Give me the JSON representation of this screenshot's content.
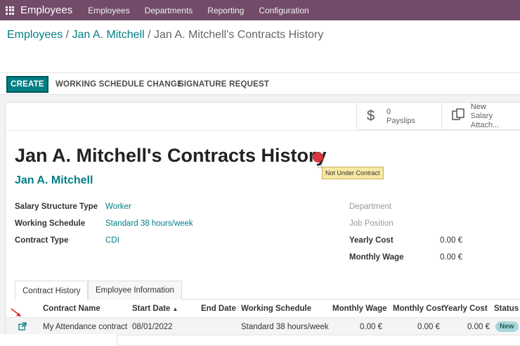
{
  "navbar": {
    "brand": "Employees",
    "items": [
      "Employees",
      "Departments",
      "Reporting",
      "Configuration"
    ]
  },
  "breadcrumb": {
    "item1": "Employees",
    "item2": "Jan A. Mitchell",
    "current": "Jan A. Mitchell's Contracts History",
    "separator": "/"
  },
  "toolbar": {
    "create": "CREATE",
    "working_schedule_change": "WORKING SCHEDULE CHANGE",
    "signature_request": "SIGNATURE REQUEST"
  },
  "smart_buttons": {
    "payslips": {
      "value": "0",
      "label": "Payslips",
      "icon": "dollar-icon"
    },
    "salary_attachments": {
      "value": "New",
      "label": "Salary Attach...",
      "icon": "documents-icon"
    }
  },
  "record": {
    "title": "Jan A. Mitchell's Contracts History",
    "status_color": "#d9363e",
    "status_tooltip": "Not Under Contract",
    "employee_name": "Jan A. Mitchell"
  },
  "fields_left": [
    {
      "label": "Salary Structure Type",
      "value": "Worker"
    },
    {
      "label": "Working Schedule",
      "value": "Standard 38 hours/week"
    },
    {
      "label": "Contract Type",
      "value": "CDI"
    }
  ],
  "fields_right": [
    {
      "label": "Department",
      "value": ""
    },
    {
      "label": "Job Position",
      "value": ""
    },
    {
      "label": "Yearly Cost",
      "value": "0.00 €"
    },
    {
      "label": "Monthly Wage",
      "value": "0.00 €"
    }
  ],
  "tabs": [
    "Contract History",
    "Employee Information"
  ],
  "table": {
    "columns": [
      "Contract Name",
      "Start Date",
      "End Date",
      "Working Schedule",
      "Monthly Wage",
      "Monthly Cost",
      "Yearly Cost",
      "Status"
    ],
    "sort_indicator": "▲",
    "rows": [
      {
        "contract_name": "My Attendance contract",
        "start_date": "08/01/2022",
        "end_date": "",
        "working_schedule": "Standard 38 hours/week",
        "monthly_wage": "0.00 €",
        "monthly_cost": "0.00 €",
        "yearly_cost": "0.00 €",
        "status": "New"
      }
    ]
  },
  "colors": {
    "navbar": "#714b67",
    "primary": "#017e84",
    "status_red": "#d9363e",
    "badge_bg": "#a8d7d9"
  }
}
